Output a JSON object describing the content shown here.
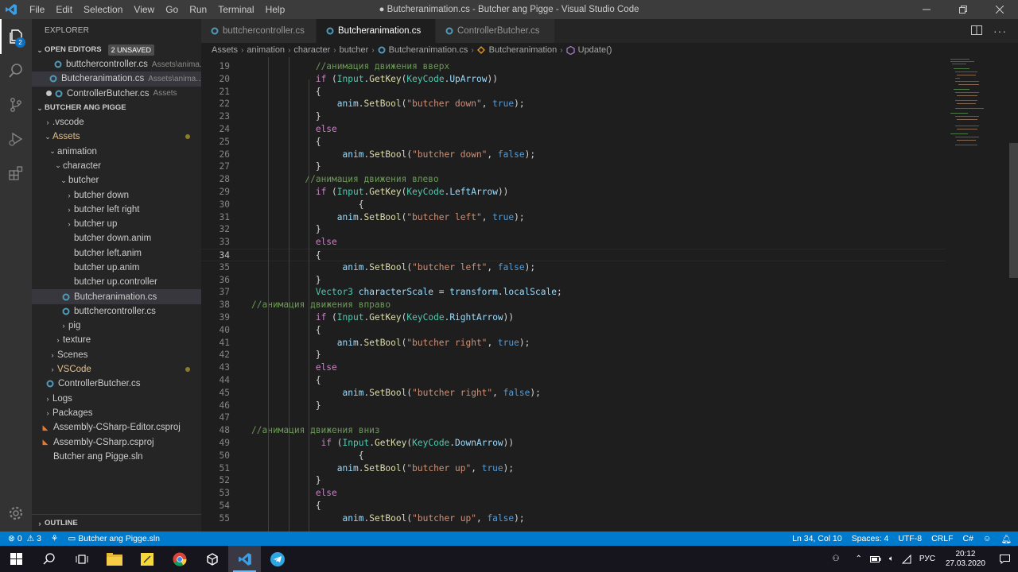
{
  "window": {
    "title": "● Butcheranimation.cs - Butcher ang Pigge - Visual Studio Code",
    "menu": [
      "File",
      "Edit",
      "Selection",
      "View",
      "Go",
      "Run",
      "Terminal",
      "Help"
    ]
  },
  "activity": {
    "explorer_badge": "2"
  },
  "sidebar": {
    "title": "EXPLORER",
    "open_editors": {
      "header": "OPEN EDITORS",
      "unsaved": "2 UNSAVED",
      "items": [
        {
          "name": "buttchercontroller.cs",
          "hint": "Assets\\anima..."
        },
        {
          "name": "Butcheranimation.cs",
          "hint": "Assets\\anima..."
        },
        {
          "name": "ControllerButcher.cs",
          "hint": "Assets"
        }
      ]
    },
    "workspace": {
      "header": "BUTCHER ANG PIGGE",
      "items": [
        ".vscode",
        "Assets",
        "animation",
        "character",
        "butcher",
        "butcher down",
        "butcher left right",
        "butcher up",
        "butcher down.anim",
        "butcher left.anim",
        "butcher up.anim",
        "butcher up.controller",
        "Butcheranimation.cs",
        "buttchercontroller.cs",
        "pig",
        "texture",
        "Scenes",
        "VSCode",
        "ControllerButcher.cs",
        "Logs",
        "Packages",
        "Assembly-CSharp-Editor.csproj",
        "Assembly-CSharp.csproj",
        "Butcher ang Pigge.sln"
      ]
    },
    "outline": "OUTLINE"
  },
  "tabs": [
    {
      "label": "buttchercontroller.cs"
    },
    {
      "label": "Butcheranimation.cs"
    },
    {
      "label": "ControllerButcher.cs"
    }
  ],
  "breadcrumb": [
    "Assets",
    "animation",
    "character",
    "butcher",
    "Butcheranimation.cs",
    "Butcheranimation",
    "Update()"
  ],
  "editor": {
    "lines": [
      {
        "n": "19",
        "t": "            //анимация движения вверх"
      },
      {
        "n": "20",
        "t": "            if (Input.GetKey(KeyCode.UpArrow))"
      },
      {
        "n": "21",
        "t": "            {"
      },
      {
        "n": "22",
        "t": "                anim.SetBool(\"butcher down\", true);"
      },
      {
        "n": "23",
        "t": "            }"
      },
      {
        "n": "24",
        "t": "            else"
      },
      {
        "n": "25",
        "t": "            {"
      },
      {
        "n": "26",
        "t": "                 anim.SetBool(\"butcher down\", false);"
      },
      {
        "n": "27",
        "t": "            }"
      },
      {
        "n": "28",
        "t": "          //анимация движения влево"
      },
      {
        "n": "29",
        "t": "            if (Input.GetKey(KeyCode.LeftArrow))"
      },
      {
        "n": "30",
        "t": "                    {"
      },
      {
        "n": "31",
        "t": "                anim.SetBool(\"butcher left\", true);"
      },
      {
        "n": "32",
        "t": "            }"
      },
      {
        "n": "33",
        "t": "            else"
      },
      {
        "n": "34",
        "t": "            {"
      },
      {
        "n": "35",
        "t": "                 anim.SetBool(\"butcher left\", false);"
      },
      {
        "n": "36",
        "t": "            }"
      },
      {
        "n": "37",
        "t": "            Vector3 characterScale = transform.localScale;"
      },
      {
        "n": "38",
        "t": "//анимация движения вправо"
      },
      {
        "n": "39",
        "t": "            if (Input.GetKey(KeyCode.RightArrow))"
      },
      {
        "n": "40",
        "t": "            {"
      },
      {
        "n": "41",
        "t": "                anim.SetBool(\"butcher right\", true);"
      },
      {
        "n": "42",
        "t": "            }"
      },
      {
        "n": "43",
        "t": "            else"
      },
      {
        "n": "44",
        "t": "            {"
      },
      {
        "n": "45",
        "t": "                 anim.SetBool(\"butcher right\", false);"
      },
      {
        "n": "46",
        "t": "            }"
      },
      {
        "n": "47",
        "t": ""
      },
      {
        "n": "48",
        "t": "//анимация движения вниз"
      },
      {
        "n": "49",
        "t": "             if (Input.GetKey(KeyCode.DownArrow))"
      },
      {
        "n": "50",
        "t": "                    {"
      },
      {
        "n": "51",
        "t": "                anim.SetBool(\"butcher up\", true);"
      },
      {
        "n": "52",
        "t": "            }"
      },
      {
        "n": "53",
        "t": "            else"
      },
      {
        "n": "54",
        "t": "            {"
      },
      {
        "n": "55",
        "t": "                 anim.SetBool(\"butcher up\", false);"
      }
    ],
    "current_line": "34"
  },
  "status": {
    "errors": "0",
    "warnings": "3",
    "solution": "Butcher ang Pigge.sln",
    "position": "Ln 34, Col 10",
    "spaces": "Spaces: 4",
    "encoding": "UTF-8",
    "eol": "CRLF",
    "language": "C#"
  },
  "taskbar": {
    "lang": "РУС",
    "time": "20:12",
    "date": "27.03.2020"
  },
  "colors": {
    "accent": "#007acc",
    "keyword": "#569cd6",
    "comment": "#6a9955",
    "string": "#ce9178",
    "type": "#4ec9b0",
    "method": "#dcdcaa"
  }
}
